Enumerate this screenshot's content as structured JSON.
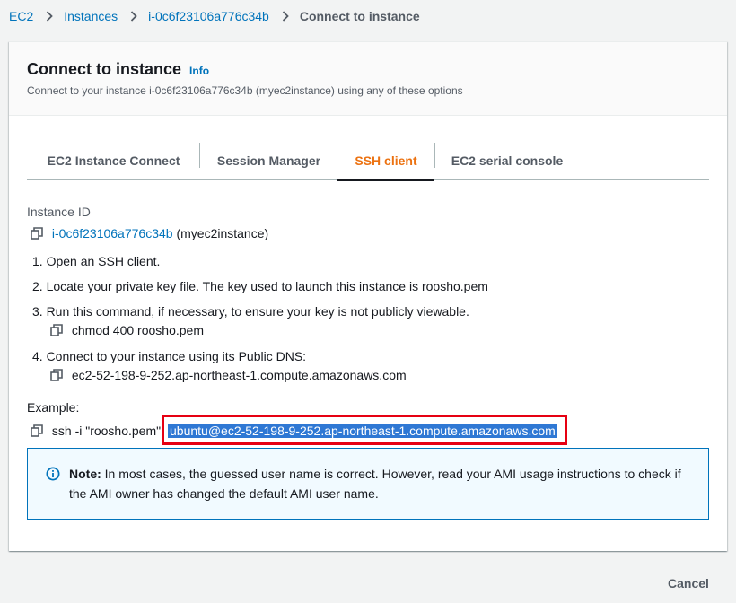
{
  "breadcrumb": {
    "items": [
      "EC2",
      "Instances",
      "i-0c6f23106a776c34b"
    ],
    "current": "Connect to instance"
  },
  "header": {
    "title": "Connect to instance",
    "info": "Info",
    "description": "Connect to your instance i-0c6f23106a776c34b (myec2instance) using any of these options"
  },
  "tabs": [
    {
      "label": "EC2 Instance Connect"
    },
    {
      "label": "Session Manager"
    },
    {
      "label": "SSH client"
    },
    {
      "label": "EC2 serial console"
    }
  ],
  "active_tab": "SSH client",
  "instance": {
    "label": "Instance ID",
    "id": "i-0c6f23106a776c34b",
    "name": "(myec2instance)"
  },
  "steps": {
    "s1": "1. Open an SSH client.",
    "s2": "2. Locate your private key file. The key used to launch this instance is roosho.pem",
    "s3": "3. Run this command, if necessary, to ensure your key is not publicly viewable.",
    "s3_cmd": "chmod 400 roosho.pem",
    "s4": "4. Connect to your instance using its Public DNS:",
    "s4_dns": "ec2-52-198-9-252.ap-northeast-1.compute.amazonaws.com"
  },
  "example": {
    "label": "Example:",
    "cmd_prefix": "ssh -i \"roosho.pem\"",
    "cmd_selected": "ubuntu@ec2-52-198-9-252.ap-northeast-1.compute.amazonaws.com"
  },
  "alert": {
    "note_label": "Note:",
    "note_text": " In most cases, the guessed user name is correct. However, read your AMI usage instructions to check if the AMI owner has changed the default AMI user name."
  },
  "footer": {
    "cancel": "Cancel"
  },
  "colors": {
    "link": "#0073bb",
    "active_tab": "#ec7211",
    "highlight_border": "#e60012",
    "selection": "#2f78d4",
    "alert_border": "#0073bb",
    "alert_bg": "#f1faff"
  }
}
